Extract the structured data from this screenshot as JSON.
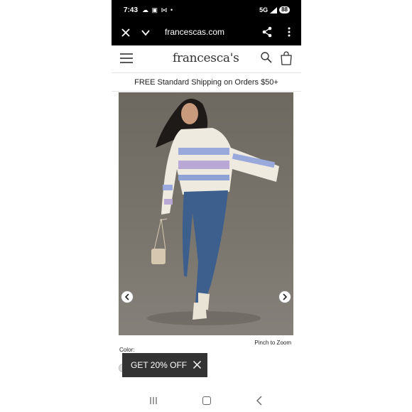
{
  "status_bar": {
    "time": "7:43",
    "icons_left": "☁ ▣ ⋈ •",
    "network": "5G",
    "battery": "88"
  },
  "browser": {
    "url": "francescas.com"
  },
  "site": {
    "logo_text": "francesca's",
    "promo_text": "FREE Standard Shipping on Orders $50+"
  },
  "product": {
    "image_alt": "Model wearing a cropped fair isle sweater with jeans",
    "zoom_hint": "Pinch to Zoom",
    "color_label": "Color:"
  },
  "discount": {
    "label": "GET 20% OFF"
  },
  "colors": {
    "sweater_blue": "#8fa2d6",
    "sweater_cream": "#f1ece1",
    "jeans": "#3c5f8e",
    "background": "#75716a"
  }
}
